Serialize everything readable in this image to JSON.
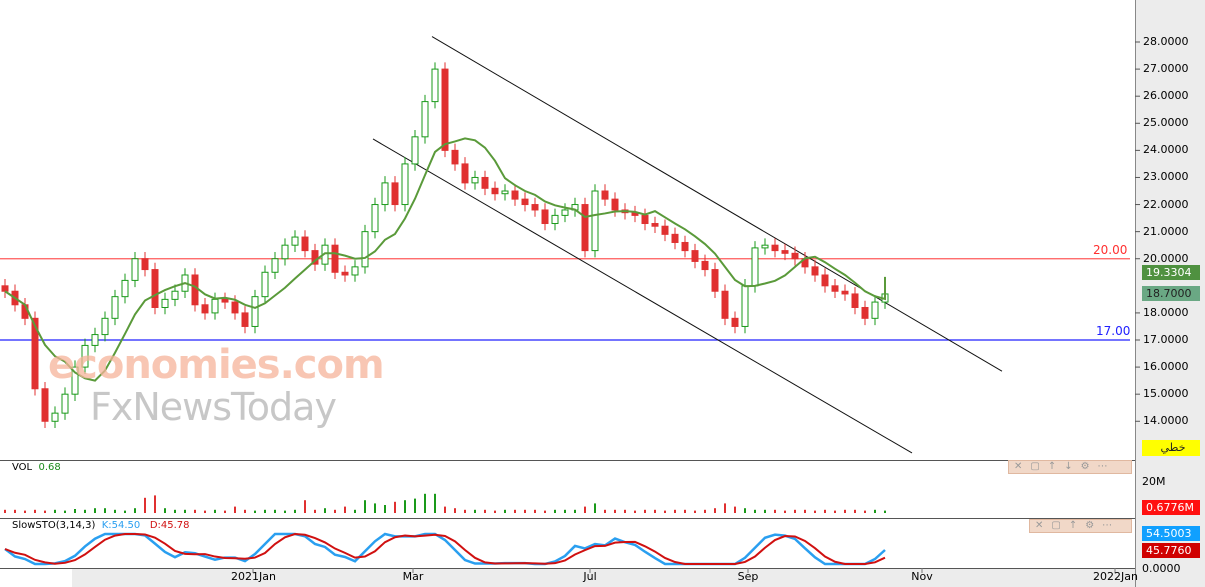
{
  "chart_data": {
    "type": "candlestick",
    "price_axis": {
      "ticks": [
        "28.0000",
        "27.0000",
        "26.0000",
        "25.0000",
        "24.0000",
        "23.0000",
        "22.0000",
        "21.0000",
        "20.0000",
        "18.0000",
        "17.0000",
        "16.0000",
        "15.0000",
        "14.0000"
      ],
      "values": [
        28,
        27,
        26,
        25,
        24,
        23,
        22,
        21,
        20,
        18,
        17,
        16,
        15,
        14
      ]
    },
    "x_labels": [
      "2021Jan",
      "Mar",
      "Jul",
      "Sep",
      "Nov",
      "2022Jan"
    ],
    "closes": [
      18.8,
      18.3,
      17.8,
      15.2,
      14.0,
      14.3,
      15.0,
      16.0,
      16.8,
      17.2,
      17.8,
      18.6,
      19.2,
      20.0,
      19.6,
      18.2,
      18.5,
      18.8,
      19.4,
      18.3,
      18.0,
      18.5,
      18.4,
      18.0,
      17.5,
      18.6,
      19.5,
      20.0,
      20.5,
      20.8,
      20.3,
      19.8,
      20.5,
      19.5,
      19.4,
      19.7,
      21.0,
      22.0,
      22.8,
      22.0,
      23.5,
      24.5,
      25.8,
      27.0,
      24.0,
      23.5,
      22.8,
      23.0,
      22.6,
      22.4,
      22.5,
      22.2,
      22.0,
      21.8,
      21.3,
      21.6,
      21.8,
      22.0,
      20.3,
      22.5,
      22.2,
      21.8,
      21.7,
      21.6,
      21.3,
      21.2,
      20.9,
      20.6,
      20.3,
      19.9,
      19.6,
      18.8,
      17.8,
      17.5,
      19.0,
      20.4,
      20.5,
      20.3,
      20.2,
      20.0,
      19.7,
      19.4,
      19.0,
      18.8,
      18.7,
      18.2,
      17.8,
      18.4,
      18.7
    ],
    "volume_m": [
      2,
      2,
      1.5,
      2,
      1.5,
      2,
      1.5,
      2.5,
      2,
      3,
      3,
      2,
      1.5,
      3,
      9.5,
      11,
      3,
      2,
      2,
      2,
      1.5,
      2,
      1.5,
      4,
      2,
      1.5,
      2,
      2,
      1.5,
      2,
      8,
      2,
      3,
      2,
      4,
      2,
      8,
      6,
      5,
      7,
      8,
      9,
      12,
      12,
      4,
      3,
      2,
      2,
      2,
      1.5,
      2,
      2,
      2,
      2,
      1.5,
      2,
      2,
      2,
      4,
      6,
      2,
      2,
      2,
      1.5,
      2,
      2,
      1.5,
      2,
      2,
      1.5,
      2,
      3,
      6,
      4,
      3,
      2,
      2,
      2,
      1.5,
      2,
      2,
      1.5,
      2,
      1.5,
      2,
      2,
      1.5,
      2,
      1.5
    ],
    "trendlines": [
      {
        "from": [
          42.7,
          28.2
        ],
        "to": [
          99.7,
          15.85
        ]
      },
      {
        "from": [
          36.8,
          24.42
        ],
        "to": [
          90.7,
          12.83
        ]
      }
    ],
    "hlines": [
      {
        "price": 20,
        "label": "20.00",
        "color": "#ff5a5a"
      },
      {
        "price": 17,
        "label": "17.00",
        "color": "#2020ff"
      }
    ],
    "ma_value": "19.3304",
    "last_price": "18.7000",
    "chart_type_label": "خطي",
    "volume": {
      "title": "VOL",
      "value": "0.68",
      "tick": "20M",
      "last": "0.6776M"
    },
    "stoch": {
      "title": "SlowSTO(3,14,3)",
      "k": "K:54.50",
      "d": "D:45.78",
      "k_last": "54.5003",
      "d_last": "45.7760",
      "tick": "0.0000"
    }
  },
  "watermark": {
    "line1": "economies.com",
    "line2": "FxNewsToday"
  },
  "colors": {
    "up": "#1a9a1a",
    "down": "#e03030",
    "ma": "#5a9a3a",
    "k": "#2a9ff0",
    "d": "#d01010"
  }
}
